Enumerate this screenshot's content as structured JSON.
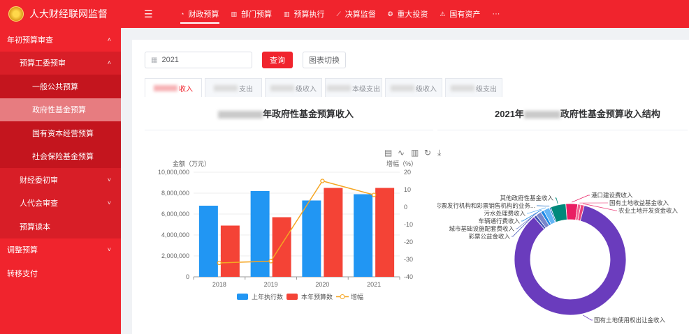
{
  "brand": {
    "title": "人大财经联网监督"
  },
  "topnav": [
    {
      "icon": "clock-icon",
      "glyph": "◔",
      "label": "财政预算",
      "active": true
    },
    {
      "icon": "bar-chart-icon",
      "glyph": "▥",
      "label": "部门预算"
    },
    {
      "icon": "bar-chart-icon",
      "glyph": "▥",
      "label": "预算执行"
    },
    {
      "icon": "line-chart-icon",
      "glyph": "⟋",
      "label": "决算监督"
    },
    {
      "icon": "coins-icon",
      "glyph": "❂",
      "label": "重大投资"
    },
    {
      "icon": "warning-icon",
      "glyph": "⚠",
      "label": "国有资产"
    },
    {
      "icon": "more-icon",
      "glyph": "",
      "label": "···"
    }
  ],
  "sidebar": {
    "items": [
      {
        "label": "年初预算审查",
        "chevron": "˄"
      },
      {
        "label": "预算工委预审",
        "chevron": "˄"
      },
      {
        "label": "一般公共预算"
      },
      {
        "label": "政府性基金预算"
      },
      {
        "label": "国有资本经营预算"
      },
      {
        "label": "社会保险基金预算"
      },
      {
        "label": "财经委初审",
        "chevron": "˅"
      },
      {
        "label": "人代会审查",
        "chevron": "˅"
      },
      {
        "label": "预算读本"
      },
      {
        "label": "调整预算",
        "chevron": "˅"
      },
      {
        "label": "转移支付"
      }
    ]
  },
  "filters": {
    "year": "2021",
    "query_label": "查询",
    "toggle_label": "图表切换"
  },
  "tabs": [
    "收入",
    "支出",
    "级收入",
    "本级支出",
    "级收入",
    "级支出"
  ],
  "left_title": {
    "prefix": "",
    "suffix": "年政府性基金预算收入"
  },
  "right_title": {
    "prefix": "2021年",
    "suffix": "政府性基金预算收入结构"
  },
  "toolbox": [
    "data-view-icon",
    "line-switch-icon",
    "bar-switch-icon",
    "restore-icon",
    "save-image-icon"
  ],
  "colors": {
    "brand_red": "#f0242d",
    "series_blue": "#2196f3",
    "series_red": "#f44336",
    "series_orange": "#f5a623"
  },
  "chart_data": [
    {
      "type": "bar",
      "title": "年政府性基金预算收入",
      "categories": [
        "2018",
        "2019",
        "2020",
        "2021"
      ],
      "series": [
        {
          "name": "上年执行数",
          "values": [
            6800000,
            8200000,
            7300000,
            7900000
          ]
        },
        {
          "name": "本年预算数",
          "values": [
            4900000,
            5700000,
            8500000,
            8500000
          ]
        },
        {
          "name": "增幅",
          "type": "line",
          "axis": "right",
          "values": [
            -32,
            -31,
            15,
            7
          ]
        }
      ],
      "ylabel": "金额（万元）",
      "y2label": "增幅（%）",
      "ylim": [
        0,
        10000000
      ],
      "y2lim": [
        -40,
        20
      ],
      "yticks": [
        "0",
        "2,000,000",
        "4,000,000",
        "6,000,000",
        "8,000,000",
        "10,000,000"
      ],
      "y2ticks": [
        "-40",
        "-30",
        "-20",
        "-10",
        "0",
        "10",
        "20"
      ],
      "legend": "bottom"
    },
    {
      "type": "pie",
      "title": "2021年政府性基金预算收入结构",
      "slices": [
        {
          "name": "国有土地使用权出让金收入",
          "value": 84,
          "color": "#6a3cbd"
        },
        {
          "name": "彩票公益金收入",
          "value": 0.8,
          "color": "#3f51b5"
        },
        {
          "name": "城市基础设施配套费收入",
          "value": 1.6,
          "color": "#7986cb"
        },
        {
          "name": "车辆通行费收入",
          "value": 0.9,
          "color": "#1e88e5"
        },
        {
          "name": "污水处理费收入",
          "value": 1.8,
          "color": "#64b5f6"
        },
        {
          "name": "彩票发行机构和彩票销售机构的业务...",
          "value": 0.4,
          "color": "#1565c0"
        },
        {
          "name": "其他政府性基金收入",
          "value": 4.4,
          "color": "#00897b"
        },
        {
          "name": "港口建设费收入",
          "value": 3.4,
          "color": "#e91e63"
        },
        {
          "name": "国有土地收益基金收入",
          "value": 0.9,
          "color": "#f06292"
        },
        {
          "name": "农业土地开发资金收入",
          "value": 1.0,
          "color": "#ec407a"
        }
      ],
      "legend": "callouts"
    }
  ]
}
